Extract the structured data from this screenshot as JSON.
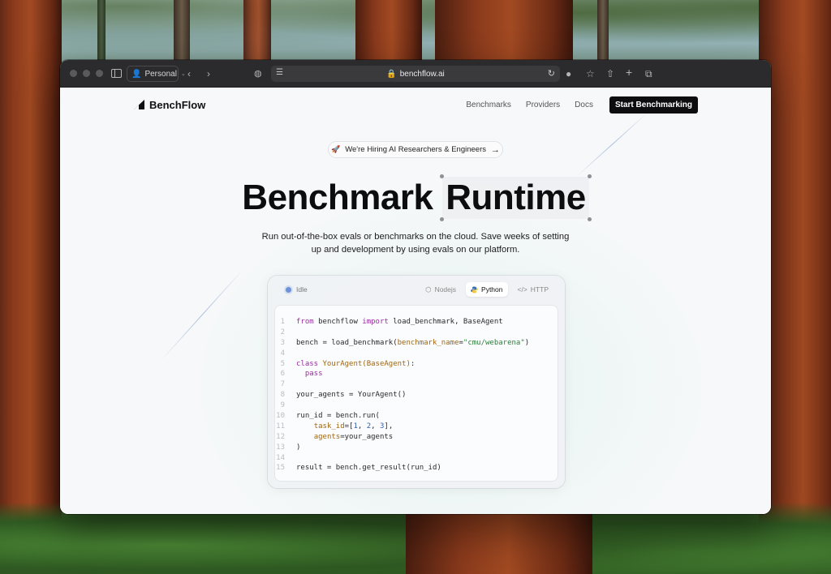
{
  "browser": {
    "profile_label": "Personal",
    "url": "benchflow.ai"
  },
  "nav": {
    "brand": "BenchFlow",
    "links": [
      "Benchmarks",
      "Providers",
      "Docs"
    ],
    "cta_label": "Start Benchmarking"
  },
  "hero": {
    "hiring_badge": "We're Hiring AI Researchers & Engineers",
    "title_part1": "Benchmark",
    "title_part2": "Runtime",
    "subtitle_line1": "Run out-of-the-box evals or benchmarks on the cloud. Save weeks of setting",
    "subtitle_line2": "up and development by using evals on our platform."
  },
  "code_card": {
    "status": "Idle",
    "tabs": [
      "Nodejs",
      "Python",
      "HTTP"
    ],
    "active_tab": "Python",
    "line_numbers": [
      "1",
      "2",
      "3",
      "4",
      "5",
      "6",
      "7",
      "8",
      "9",
      "10",
      "11",
      "12",
      "13",
      "14",
      "15"
    ],
    "lines": [
      "from benchflow import load_benchmark, BaseAgent",
      "",
      "bench = load_benchmark(benchmark_name=\"cmu/webarena\")",
      "",
      "class YourAgent(BaseAgent):",
      "  pass",
      "",
      "your_agents = YourAgent()",
      "",
      "run_id = bench.run(",
      "    task_id=[1, 2, 3],",
      "    agents=your_agents",
      ")",
      "",
      "result = bench.get_result(run_id)"
    ]
  },
  "colors": {
    "keyword": "#9b2aa3",
    "class_name": "#a0650f",
    "string": "#2f7d3a",
    "number": "#2f5fb8",
    "status_dot": "#6d93d6"
  }
}
